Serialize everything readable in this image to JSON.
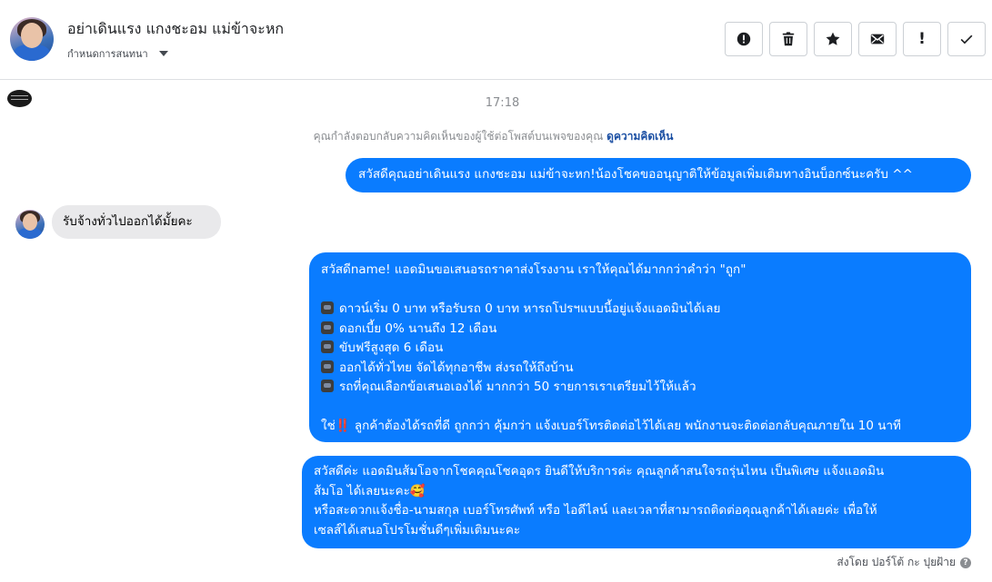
{
  "header": {
    "contact_name": "อย่าเดินแรง แกงชะอม แม่ข้าจะหก",
    "assign_label": "กำหนดการสนทนา",
    "toolbar": [
      {
        "name": "spam-button",
        "icon": "alert-circle-icon"
      },
      {
        "name": "delete-button",
        "icon": "trash-icon"
      },
      {
        "name": "star-button",
        "icon": "star-icon"
      },
      {
        "name": "unread-button",
        "icon": "envelope-icon"
      },
      {
        "name": "follow-up-button",
        "icon": "exclamation-icon",
        "glyph": "!"
      },
      {
        "name": "done-button",
        "icon": "check-icon"
      }
    ]
  },
  "conversation": {
    "timestamp": "17:18",
    "notice": {
      "text": "คุณกำลังตอบกลับความคิดเห็นของผู้ใช้ต่อโพสต์บนเพจของคุณ",
      "link": "ดูความคิดเห็น"
    },
    "messages": [
      {
        "from": "page",
        "lines": [
          "สวัสดีคุณอย่าเดินแรง แกงชะอม แม่ข้าจะหก!น้องโชคขออนุญาติให้ข้อมูลเพิ่มเติมทางอินบ็อกซ์นะครับ ^^"
        ]
      },
      {
        "from": "user",
        "lines": [
          "รับจ้างทั่วไปออกได้มั้ยคะ"
        ]
      },
      {
        "from": "page",
        "lines": [
          "สวัสดีname! แอดมินขอเสนอรถราคาส่งโรงงาน เราให้คุณได้มากกว่าคำว่า \"ถูก\"",
          "",
          "ดาวน์เริ่ม 0 บาท หรือรับรถ 0 บาท หารถโปรฯแบบนี้อยู่แจ้งแอดมินได้เลย",
          "ดอกเบี้ย 0% นานถึง 12 เดือน",
          "ขับฟรีสูงสุด 6 เดือน",
          "ออกได้ทั่วไทย จัดได้ทุกอาชีพ ส่งรถให้ถึงบ้าน",
          "รถที่คุณเลือกข้อเสนอเองได้ มากกว่า 50 รายการเราเตรียมไว้ให้แล้ว",
          "",
          "ใช่‼️ ลูกค้าต้องได้รถที่ดี ถูกกว่า คุ้มกว่า แจ้งเบอร์โทรติดต่อไว้ได้เลย พนักงานจะติดต่อกลับคุณภายใน 10 นาที"
        ]
      },
      {
        "from": "page",
        "lines": [
          "สวัสดีค่ะ แอดมินส้มโอจากโชคคุณโชคอุดร ยินดีให้บริการค่ะ   คุณลูกค้าสนใจรถรุ่นไหน เป็นพิเศษ แจ้งแอดมิน",
          "ส้มโอ ได้เลยนะคะ🥰",
          "หรือสะดวกแจ้งชื่อ-นามสกุล เบอร์โทรศัพท์ หรือ ไอดีไลน์ และเวลาที่สามารถติดต่อคุณลูกค้าได้เลยค่ะ เพื่อให้",
          "เซลส์ได้เสนอโปรโมชั่นดีๆเพิ่มเติมนะคะ"
        ]
      }
    ],
    "bullet_icon_name": "car-emoji-icon",
    "sent_by": "ส่งโดย ปอร์โต้ กะ ปุยฝ้าย"
  },
  "colors": {
    "outgoing_bubble": "#0a7cff",
    "incoming_bubble": "#e9e9eb",
    "link": "#1b4fa3"
  }
}
